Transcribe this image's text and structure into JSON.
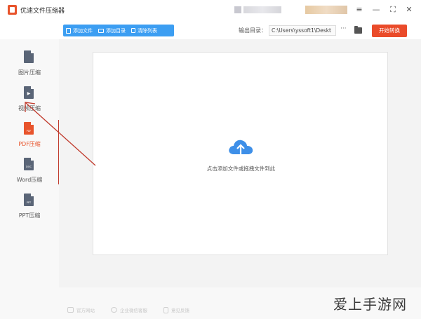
{
  "app": {
    "title": "优速文件压缩器"
  },
  "window_controls": {
    "menu": "≡",
    "minimize": "—",
    "maximize": "⛶",
    "close": "✕"
  },
  "toolbar": {
    "add_file": "添加文件",
    "add_folder": "添加目录",
    "clear_list": "清除列表",
    "output_label": "输出目录：",
    "output_path": "C:\\Users\\yssoft1\\Deskt",
    "more": "···",
    "start": "开始转换"
  },
  "sidebar": {
    "items": [
      {
        "label": "图片压缩",
        "tag": "",
        "active": false
      },
      {
        "label": "视频压缩",
        "tag": "▶",
        "active": false
      },
      {
        "label": "PDF压缩",
        "tag": "PDF",
        "active": true
      },
      {
        "label": "Word压缩",
        "tag": "DOC",
        "active": false
      },
      {
        "label": "PPT压缩",
        "tag": "PPT",
        "active": false
      }
    ]
  },
  "dropzone": {
    "hint": "点击添加文件或拖拽文件到此"
  },
  "footer": {
    "website": "官方网站",
    "wechat": "企业微信客服",
    "feedback": "意见反馈"
  },
  "watermark": {
    "text": "爱上手游网"
  },
  "colors": {
    "accent_blue": "#3c9ef2",
    "accent_orange": "#ea4b2a",
    "cloud_blue": "#3e8fe8"
  }
}
